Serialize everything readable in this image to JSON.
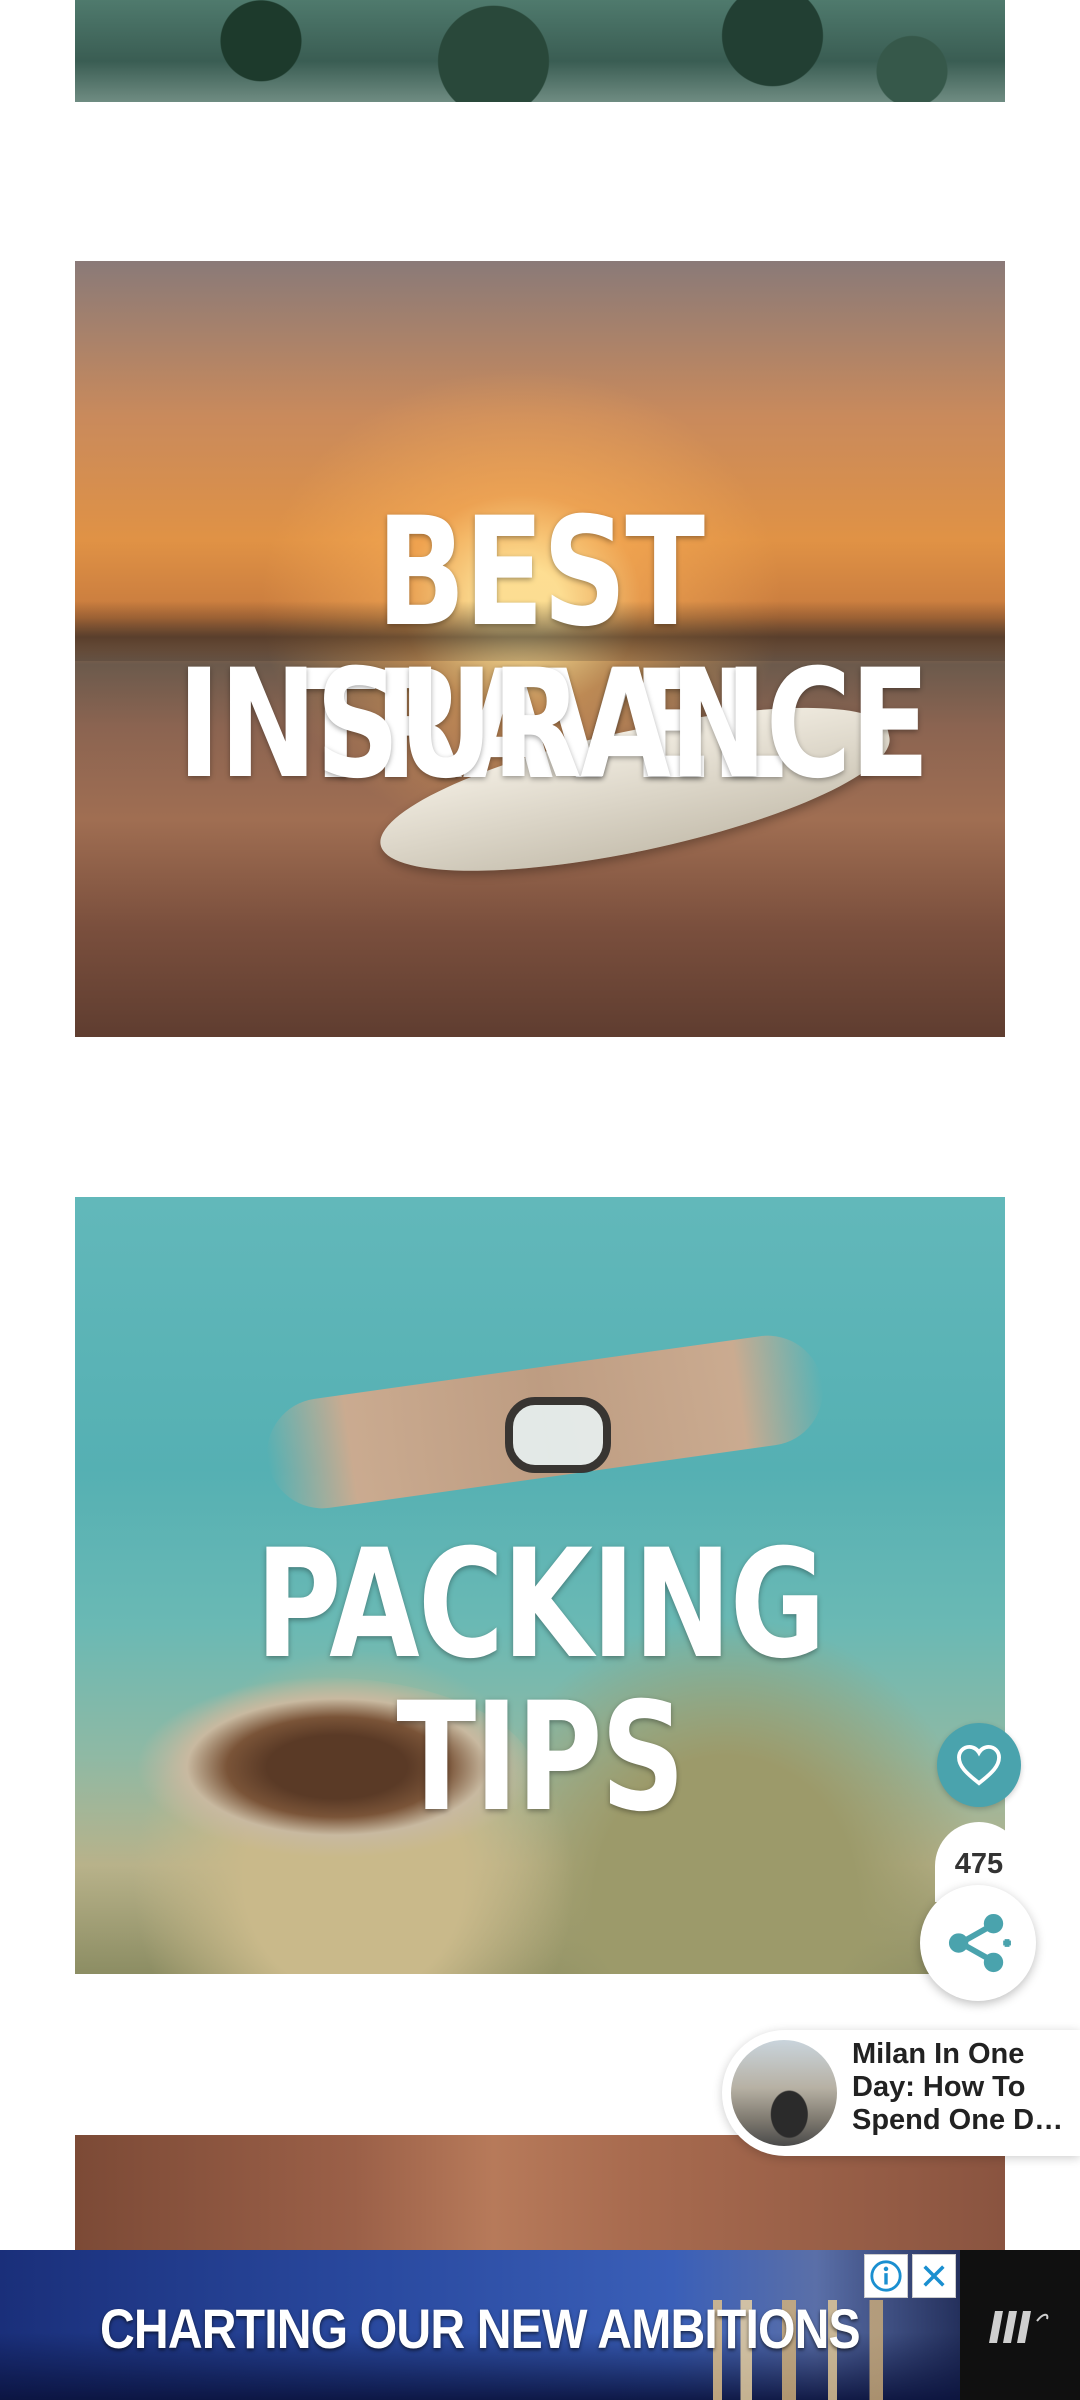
{
  "tiles": [
    {
      "id": "reef",
      "caption": ""
    },
    {
      "id": "insurance",
      "caption_line1": "BEST TRAVEL",
      "caption_line2": "INSURANCE"
    },
    {
      "id": "packing",
      "caption": "PACKING TIPS"
    },
    {
      "id": "petra",
      "caption": ""
    }
  ],
  "social": {
    "share_count": "475",
    "favorite_icon": "heart-icon",
    "share_icon": "share-icon",
    "accent_color": "#4aa3ad"
  },
  "related_post": {
    "title": "Milan In One Day: How To Spend One Day In Milan"
  },
  "ad": {
    "headline": "CHARTING OUR NEW AMBITIONS",
    "info_icon": "info-icon",
    "close_icon": "close-icon"
  }
}
